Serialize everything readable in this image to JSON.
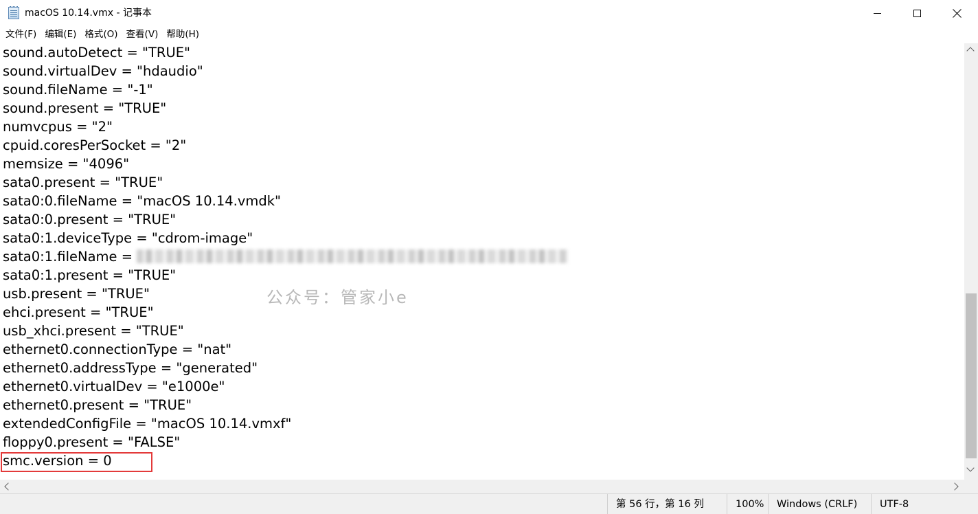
{
  "window": {
    "title": "macOS 10.14.vmx - 记事本",
    "icons": {
      "app": "notepad-icon"
    }
  },
  "menu": [
    "文件(F)",
    "编辑(E)",
    "格式(O)",
    "查看(V)",
    "帮助(H)"
  ],
  "editor": {
    "lines": [
      "sound.autoDetect = \"TRUE\"",
      "sound.virtualDev = \"hdaudio\"",
      "sound.fileName = \"-1\"",
      "sound.present = \"TRUE\"",
      "numvcpus = \"2\"",
      "cpuid.coresPerSocket = \"2\"",
      "memsize = \"4096\"",
      "sata0.present = \"TRUE\"",
      "sata0:0.fileName = \"macOS 10.14.vmdk\"",
      "sata0:0.present = \"TRUE\"",
      "sata0:1.deviceType = \"cdrom-image\"",
      "sata0:1.fileName = ",
      "sata0:1.present = \"TRUE\"",
      "usb.present = \"TRUE\"",
      "ehci.present = \"TRUE\"",
      "usb_xhci.present = \"TRUE\"",
      "ethernet0.connectionType = \"nat\"",
      "ethernet0.addressType = \"generated\"",
      "ethernet0.virtualDev = \"e1000e\"",
      "ethernet0.present = \"TRUE\"",
      "extendedConfigFile = \"macOS 10.14.vmxf\"",
      "floppy0.present = \"FALSE\"",
      "smc.version = 0"
    ],
    "highlight_color": "#e33a3a",
    "watermark": "公众号：管家小e"
  },
  "status": {
    "position": "第 56 行，第 16 列",
    "zoom": "100%",
    "line_ending": "Windows (CRLF)",
    "encoding": "UTF-8"
  }
}
